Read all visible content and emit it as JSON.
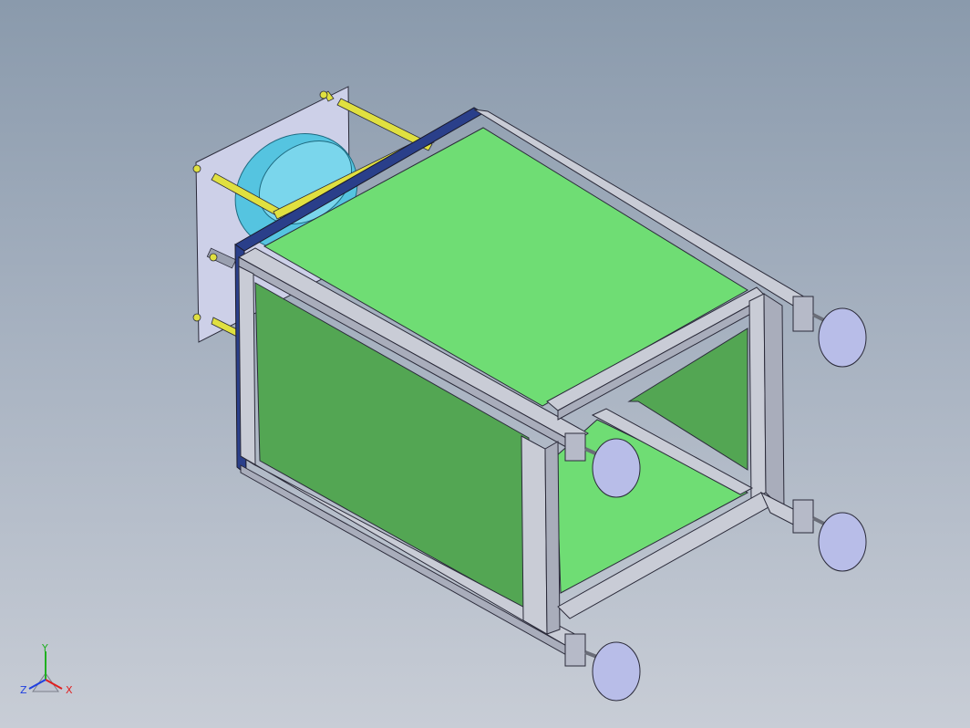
{
  "viewport": {
    "background_top": "#8a9aac",
    "background_bottom": "#c8cdd6"
  },
  "model": {
    "panel_color_light": "#6fdd74",
    "panel_color_dark": "#53a653",
    "frame_color": "#c9ccd6",
    "flange_plate_color": "#cdd0e8",
    "disc_color": "#55c4e0",
    "rod_color": "#e0e040",
    "foot_color": "#b8bde8",
    "edge_color": "#2b2b3a"
  },
  "triad": {
    "x_label": "X",
    "y_label": "Y",
    "z_label": "Z",
    "x_color": "#e02020",
    "y_color": "#20b020",
    "z_color": "#2040e0"
  }
}
